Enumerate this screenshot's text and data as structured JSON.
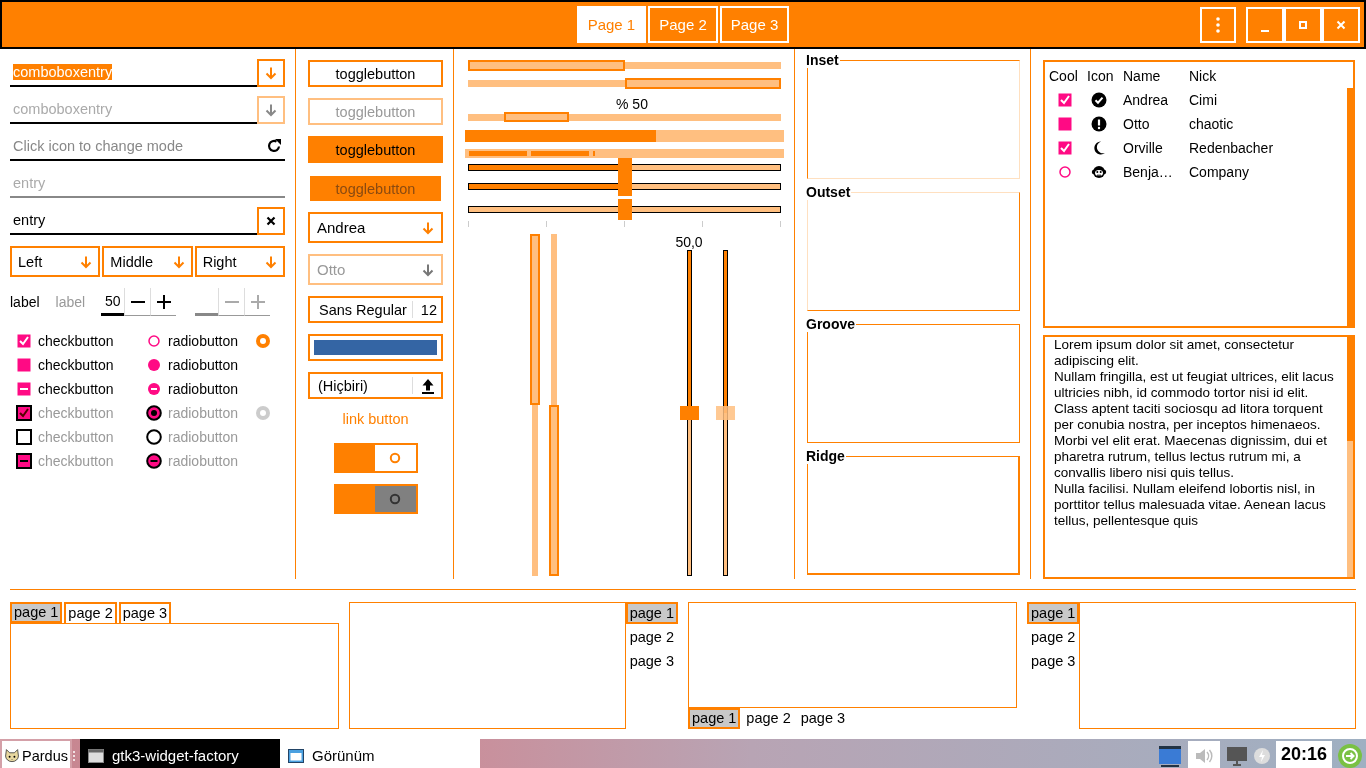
{
  "header": {
    "tabs": [
      {
        "label": "Page 1",
        "selected": true
      },
      {
        "label": "Page 2",
        "selected": false
      },
      {
        "label": "Page 3",
        "selected": false
      }
    ]
  },
  "entries": [
    {
      "kind": "combo",
      "value": "comboboxentry",
      "text_selected": true,
      "disabled": false
    },
    {
      "kind": "combo",
      "value": "comboboxentry",
      "text_selected": false,
      "disabled": true
    },
    {
      "kind": "icon",
      "placeholder": "Click icon to change mode",
      "disabled": false
    },
    {
      "kind": "plain",
      "value": "entry",
      "text_selected": false,
      "disabled": true
    },
    {
      "kind": "clear",
      "value": "entry",
      "text_selected": false,
      "disabled": false
    }
  ],
  "combos": [
    {
      "label": "Left"
    },
    {
      "label": "Middle"
    },
    {
      "label": "Right"
    }
  ],
  "labels": [
    {
      "text": "label",
      "disabled": false
    },
    {
      "text": "label",
      "disabled": true
    }
  ],
  "spins": [
    {
      "value": "50",
      "disabled": false
    },
    {
      "disabled": true
    }
  ],
  "checks": [
    {
      "check": {
        "label": "checkbutton",
        "checked": true,
        "inconsistent": false
      },
      "radio": {
        "label": "radiobutton",
        "checked": false,
        "inconsistent": false
      },
      "lone_radio": true,
      "disabled": false
    },
    {
      "check": {
        "label": "checkbutton",
        "checked": false,
        "inconsistent": false
      },
      "radio": {
        "label": "radiobutton",
        "checked": true,
        "inconsistent": false
      },
      "lone_radio": false,
      "disabled": false
    },
    {
      "check": {
        "label": "checkbutton",
        "checked": false,
        "inconsistent": true
      },
      "radio": {
        "label": "radiobutton",
        "checked": false,
        "inconsistent": true
      },
      "lone_radio": false,
      "disabled": false
    },
    {
      "check": {
        "label": "checkbutton",
        "checked": true,
        "inconsistent": false
      },
      "radio": {
        "label": "radiobutton",
        "checked": true,
        "inconsistent": false
      },
      "lone_radio": true,
      "disabled": true
    },
    {
      "check": {
        "label": "checkbutton",
        "checked": false,
        "inconsistent": false
      },
      "radio": {
        "label": "radiobutton",
        "checked": false,
        "inconsistent": false
      },
      "lone_radio": false,
      "disabled": true
    },
    {
      "check": {
        "label": "checkbutton",
        "checked": false,
        "inconsistent": true
      },
      "radio": {
        "label": "radiobutton",
        "checked": false,
        "inconsistent": true
      },
      "lone_radio": false,
      "disabled": true
    }
  ],
  "toggles": [
    {
      "label": "togglebutton",
      "active": false,
      "disabled": false
    },
    {
      "label": "togglebutton",
      "active": false,
      "disabled": true
    },
    {
      "label": "togglebutton",
      "active": true,
      "disabled": false
    },
    {
      "label": "togglebutton",
      "active": true,
      "disabled": true
    }
  ],
  "people_combos": [
    {
      "value": "Andrea",
      "disabled": false
    },
    {
      "value": "Otto",
      "disabled": true
    }
  ],
  "font_button": {
    "family": "Sans Regular",
    "size": "12"
  },
  "color_button": {
    "color": "#3465a4"
  },
  "file_button": {
    "label": "(Hiçbiri)"
  },
  "link_button": {
    "label": "link button"
  },
  "switches": [
    {
      "on": true,
      "disabled": false
    },
    {
      "on": true,
      "disabled": true
    }
  ],
  "progress": [
    {
      "level": 0.5,
      "inverted": false
    },
    {
      "level": 0.5,
      "inverted": true
    }
  ],
  "pulse": {
    "text": "% 50"
  },
  "bars": [
    {
      "kind": "continuous",
      "level": 0.6
    },
    {
      "kind": "segmented",
      "level": 0.4
    }
  ],
  "scales": [
    {
      "level": 0.5,
      "filled": true,
      "marks": false
    },
    {
      "level": 0.5,
      "filled": true,
      "marks": false
    },
    {
      "level": 0.5,
      "filled": false,
      "marks": true
    }
  ],
  "vprogress": [
    {
      "level": 0.5,
      "inverted": false
    },
    {
      "level": 0.5,
      "inverted": true
    }
  ],
  "vscales": [
    {
      "level": 0.5,
      "value": "50,0",
      "disabled": false
    },
    {
      "level": 0.5,
      "disabled": true
    }
  ],
  "frames": [
    {
      "label": "Inset",
      "kind": "inset"
    },
    {
      "label": "Outset",
      "kind": "outset"
    },
    {
      "label": "Groove",
      "kind": "groove"
    },
    {
      "label": "Ridge",
      "kind": "ridge"
    }
  ],
  "tree": {
    "columns": [
      "Cool",
      "Icon",
      "Name",
      "Nick"
    ],
    "rows": [
      {
        "cool": {
          "kind": "check",
          "checked": true
        },
        "name": "Andrea",
        "nick": "Cimi"
      },
      {
        "cool": {
          "kind": "check",
          "checked": false
        },
        "name": "Otto",
        "nick": "chaotic"
      },
      {
        "cool": {
          "kind": "check",
          "checked": true
        },
        "name": "Orville",
        "nick": "Redenbacher"
      },
      {
        "cool": {
          "kind": "radio",
          "checked": false
        },
        "name": "Benja…",
        "nick": "Company"
      }
    ]
  },
  "text_view": {
    "paragraphs": [
      "Lorem ipsum dolor sit amet, consectetur adipiscing elit.",
      "Nullam fringilla, est ut feugiat ultrices, elit lacus ultricies nibh, id commodo tortor nisi id elit.",
      "Class aptent taciti sociosqu ad litora torquent per conubia nostra, per inceptos himenaeos.",
      "Morbi vel elit erat. Maecenas dignissim, dui et pharetra rutrum, tellus lectus rutrum mi, a convallis libero nisi quis tellus.",
      "Nulla facilisi. Nullam eleifend lobortis nisl, in porttitor tellus malesuada vitae. Aenean lacus tellus, pellentesque quis"
    ]
  },
  "notebooks": [
    {
      "kind": "top",
      "tabs": [
        {
          "label": "page 1",
          "selected": true
        },
        {
          "label": "page 2",
          "selected": false
        },
        {
          "label": "page 3",
          "selected": false
        }
      ]
    },
    {
      "kind": "right",
      "tabs": [
        {
          "label": "page 1",
          "selected": true
        },
        {
          "label": "page 2",
          "selected": false
        },
        {
          "label": "page 3",
          "selected": false
        }
      ]
    },
    {
      "kind": "bottom",
      "tabs": [
        {
          "label": "page 1",
          "selected": true
        },
        {
          "label": "page 2",
          "selected": false
        },
        {
          "label": "page 3",
          "selected": false
        }
      ]
    },
    {
      "kind": "left",
      "tabs": [
        {
          "label": "page 1",
          "selected": true
        },
        {
          "label": "page 2",
          "selected": false
        },
        {
          "label": "page 3",
          "selected": false
        }
      ]
    }
  ],
  "taskbar": {
    "start": {
      "label": "Pardus"
    },
    "tasks": [
      {
        "label": "gtk3-widget-factory",
        "selected": true
      },
      {
        "label": "Görünüm",
        "selected": false
      }
    ],
    "clock": "20:16"
  }
}
